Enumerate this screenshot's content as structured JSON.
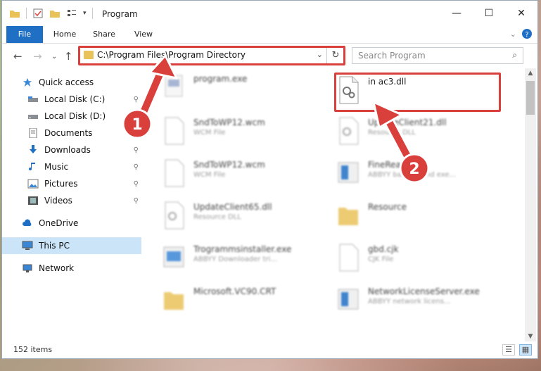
{
  "window": {
    "title": "Program"
  },
  "window_controls": {
    "minimize": "—",
    "maximize": "☐",
    "close": "✕"
  },
  "ribbon": {
    "tabs": [
      "File",
      "Home",
      "Share",
      "View"
    ]
  },
  "nav": {
    "back": "←",
    "forward": "→",
    "up": "↑",
    "recent": "⌄"
  },
  "address": {
    "path": "C:\\Program Files\\Program Directory",
    "refresh": "↻",
    "dropdown": "⌄"
  },
  "search": {
    "placeholder": "Search Program",
    "icon": "⌕"
  },
  "sidebar": {
    "items": [
      {
        "label": "Quick access",
        "icon": "star-icon",
        "pinned": false
      },
      {
        "label": "Local Disk (C:)",
        "icon": "drive-icon",
        "pinned": true
      },
      {
        "label": "Local Disk (D:)",
        "icon": "drive-icon",
        "pinned": true
      },
      {
        "label": "Documents",
        "icon": "documents-icon",
        "pinned": true
      },
      {
        "label": "Downloads",
        "icon": "download-icon",
        "pinned": true
      },
      {
        "label": "Music",
        "icon": "music-icon",
        "pinned": true
      },
      {
        "label": "Pictures",
        "icon": "pictures-icon",
        "pinned": true
      },
      {
        "label": "Videos",
        "icon": "videos-icon",
        "pinned": true
      },
      {
        "label": "OneDrive",
        "icon": "cloud-icon",
        "pinned": false
      },
      {
        "label": "This PC",
        "icon": "computer-icon",
        "pinned": false
      },
      {
        "label": "Network",
        "icon": "network-icon",
        "pinned": false
      }
    ],
    "pin_glyph": "⚲"
  },
  "files": [
    {
      "name": "program.exe",
      "type": ""
    },
    {
      "name": "in ac3.dll",
      "type": ""
    },
    {
      "name": "SndToWP12.wcm",
      "type": "WCM File"
    },
    {
      "name": "UpdateClient21.dll",
      "type": "Resource DLL"
    },
    {
      "name": "SndToWP12.wcm",
      "type": "WCM File"
    },
    {
      "name": "FineReader",
      "type": "ABBYY background exe..."
    },
    {
      "name": "UpdateClient65.dll",
      "type": "Resource DLL"
    },
    {
      "name": "Resource",
      "type": ""
    },
    {
      "name": "Trogrammsinstaller.exe",
      "type": "ABBYY Downloader tri..."
    },
    {
      "name": "gbd.cjk",
      "type": "CJK File"
    },
    {
      "name": "Microsoft.VC90.CRT",
      "type": ""
    },
    {
      "name": "NetworkLicenseServer.exe",
      "type": "ABBYY network licens..."
    }
  ],
  "status": {
    "count": "152 items"
  },
  "annotations": {
    "step1": "1",
    "step2": "2"
  },
  "colors": {
    "accent": "#1f6fc5",
    "highlight": "#d9403c",
    "selection": "#cce4f7"
  }
}
